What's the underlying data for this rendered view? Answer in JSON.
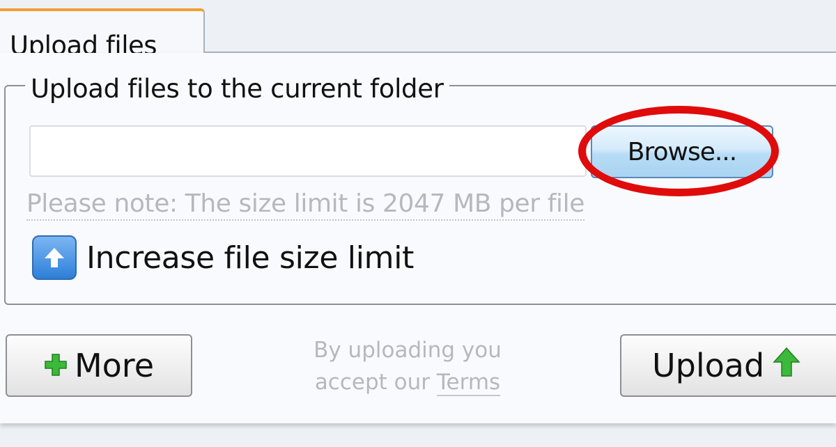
{
  "tabs": [
    {
      "label": "Upload files"
    }
  ],
  "form": {
    "legend": "Upload files to the current folder",
    "file_input_value": "",
    "browse_label": "Browse...",
    "note": "Please note: The size limit is 2047 MB per file",
    "increase_label": "Increase file size limit"
  },
  "footer": {
    "more_label": "More",
    "terms_line1": "By uploading you",
    "terms_prefix": "accept our ",
    "terms_link": "Terms",
    "upload_label": "Upload"
  },
  "icons": {
    "tab": "none",
    "increase": "arrow-up-icon",
    "more": "plus-icon",
    "upload": "arrow-up-icon",
    "highlight": "red-ellipse-annotation"
  },
  "colors": {
    "tab_accent": "#f0a030",
    "highlight": "#e00b0b",
    "browse_fill": "#bfe0f8",
    "green_icon": "#3cb83a",
    "blue_badge": "#2d7fd8"
  }
}
